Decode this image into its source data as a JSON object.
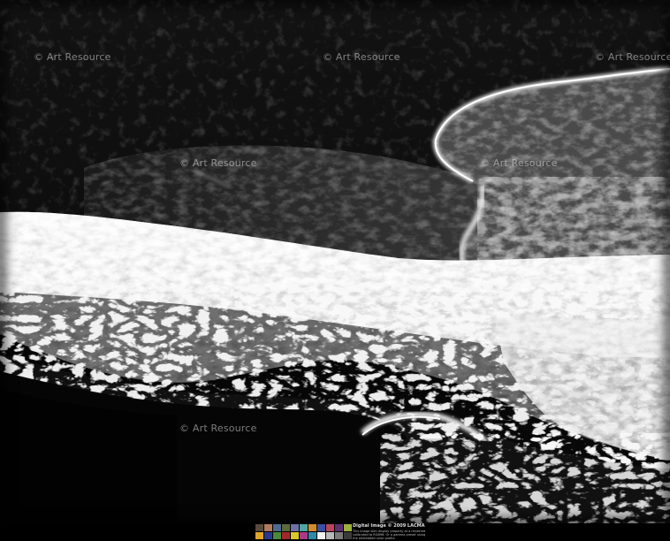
{
  "watermarks": [
    {
      "id": "wm-1",
      "text": "© Art Resource"
    },
    {
      "id": "wm-2",
      "text": "© Art Resource"
    },
    {
      "id": "wm-3",
      "text": "© Art Resource"
    },
    {
      "id": "wm-4",
      "text": "© Art Resource"
    },
    {
      "id": "wm-5",
      "text": "© Art Resource"
    },
    {
      "id": "wm-6",
      "text": "© Art Resource"
    }
  ],
  "credit": {
    "main": "Digital Image © 2009 LACMA",
    "line1": "This image with display property at a rendered",
    "line2": "calibrated to RGB96. Or a gamma preset using",
    "line3": "the embedded color profile."
  },
  "color_target": {
    "top_row": [
      "#5a4a3c",
      "#b07a5f",
      "#4e6a8e",
      "#5b6b3a",
      "#6f70a8",
      "#4fa6a0",
      "#d48a2a",
      "#3b4fa0",
      "#b7455c",
      "#5d2f6e",
      "#9bb03a"
    ],
    "bottom_row": [
      "#e0a428",
      "#2a3a8a",
      "#4a8a3a",
      "#a02a2a",
      "#d8c82a",
      "#a83a8a",
      "#2a8aa8",
      "#f2f2f2",
      "#b8b8b8",
      "#7a7a7a",
      "#3a3a3a"
    ]
  }
}
